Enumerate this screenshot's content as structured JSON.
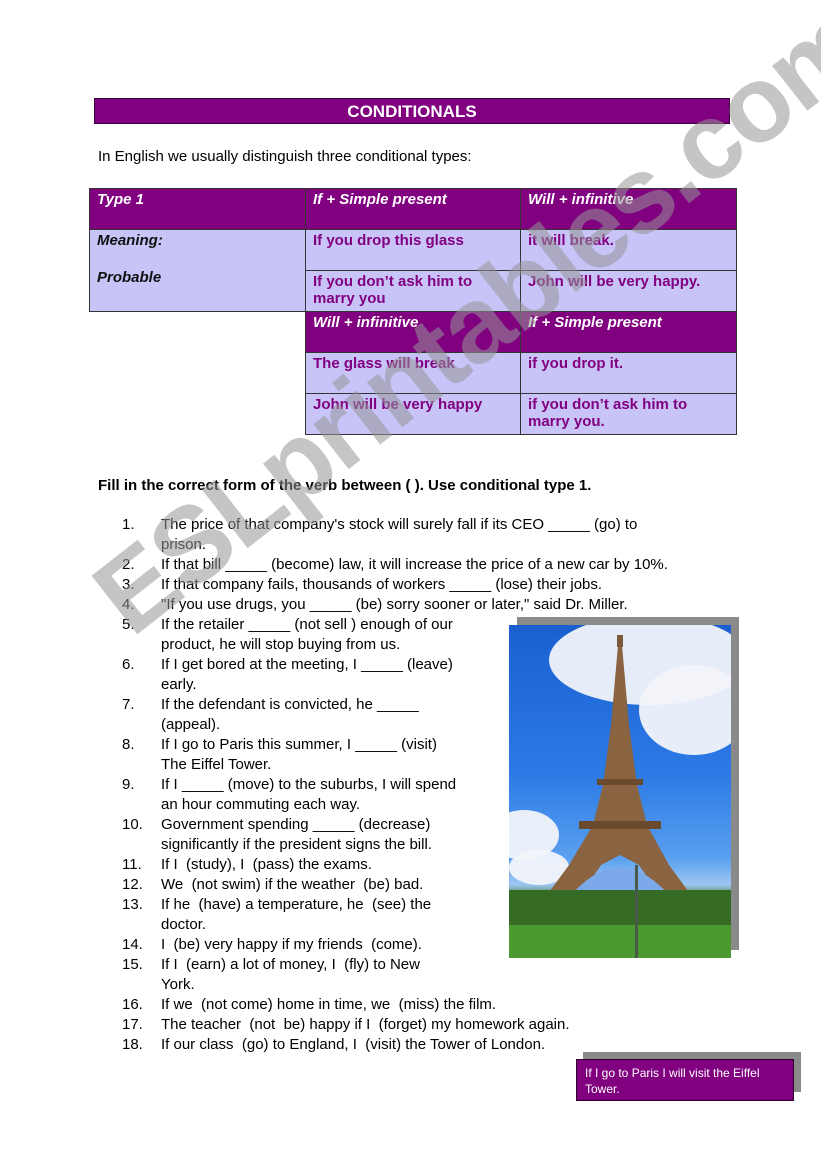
{
  "title": "CONDITIONALS",
  "intro": "In English we usually distinguish three conditional types:",
  "table1": {
    "header": [
      "Type 1",
      "If + Simple present",
      "Will + infinitive"
    ],
    "label_meaning": "Meaning:",
    "label_probable": "Probable",
    "rows": [
      [
        "If you drop this glass",
        "it will break."
      ],
      [
        "If you don’t ask him to marry you",
        "John will be very happy."
      ]
    ]
  },
  "table2": {
    "header": [
      "Will + infinitive",
      "If + Simple present"
    ],
    "rows": [
      [
        "The glass will break",
        "if you drop it."
      ],
      [
        "John will be very happy",
        "if you don’t ask him to marry you."
      ]
    ]
  },
  "instruction": "Fill in the correct form of the verb between ( ). Use conditional type 1.",
  "exercises": [
    {
      "num": "1.",
      "text": "The price of that company's stock will surely fall if its CEO _____ (go) to",
      "cont": "prison."
    },
    {
      "num": "2.",
      "text": "If that bill _____ (become) law, it will increase the price of a new car by 10%."
    },
    {
      "num": "3.",
      "text": "If that company fails, thousands of workers _____ (lose) their jobs."
    },
    {
      "num": "4.",
      "text": "\"If you use drugs, you _____ (be) sorry sooner or later,\" said Dr. Miller."
    },
    {
      "num": "5.",
      "text": "If the retailer _____ (not sell ) enough of our",
      "cont": "product, he will stop buying from us."
    },
    {
      "num": "6.",
      "text": "If I get bored at the meeting, I _____ (leave)",
      "cont": "early."
    },
    {
      "num": "7.",
      "text": "If the defendant is convicted, he _____",
      "cont": "(appeal)."
    },
    {
      "num": "8.",
      "text": "If I go to Paris this summer, I _____ (visit)",
      "cont": "The Eiffel Tower."
    },
    {
      "num": "9.",
      "text": "If I _____ (move) to the suburbs, I will spend",
      "cont": "an hour commuting each way."
    },
    {
      "num": "10.",
      "text": "Government spending _____ (decrease)",
      "cont": "significantly if the president signs the bill."
    },
    {
      "num": "11.",
      "text": "If I  (study), I  (pass) the exams."
    },
    {
      "num": "12.",
      "text": "We  (not swim) if the weather  (be) bad."
    },
    {
      "num": "13.",
      "text": "If he  (have) a temperature, he  (see) the",
      "cont": "doctor."
    },
    {
      "num": "14.",
      "text": "I  (be) very happy if my friends  (come)."
    },
    {
      "num": "15.",
      "text": "If I  (earn) a lot of money, I  (fly) to New",
      "cont": "York."
    },
    {
      "num": "16.",
      "text": "If we  (not come) home in time, we  (miss) the film."
    },
    {
      "num": "17.",
      "text": "The teacher  (not  be) happy if I  (forget) my homework again."
    },
    {
      "num": "18.",
      "text": "If our class  (go) to England, I  (visit) the Tower of London."
    }
  ],
  "photo_alt": "Eiffel Tower photo",
  "note": "If I go to Paris I will visit the Eiffel Tower.",
  "watermark": "ESLprintables.com",
  "colors": {
    "header_purple": "#800080",
    "cell_lavender": "#c8c4f8",
    "shadow_gray": "#8a8a8a"
  }
}
